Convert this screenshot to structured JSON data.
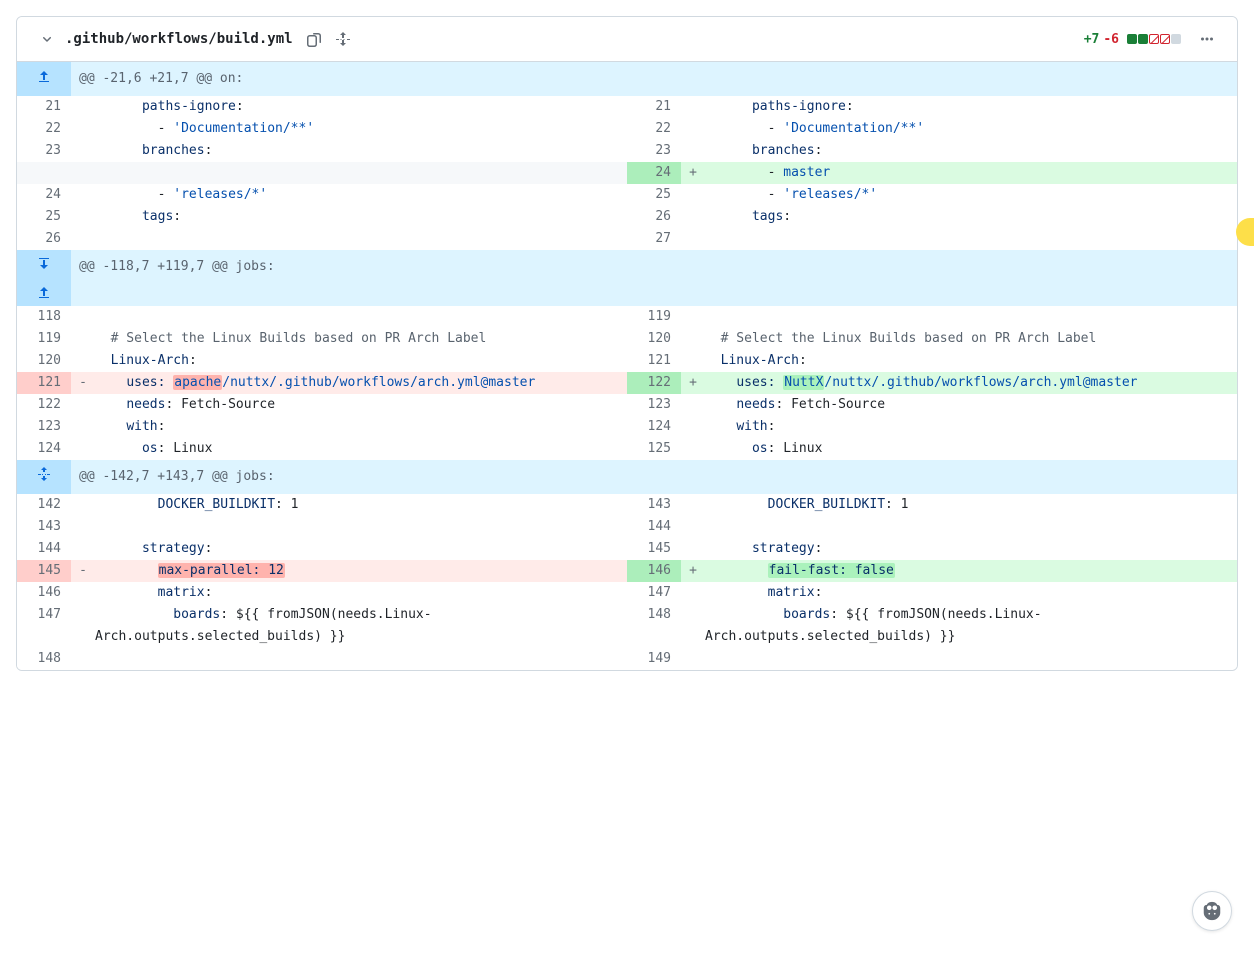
{
  "file": {
    "path": ".github/workflows/build.yml",
    "stats": {
      "additions": "+7",
      "deletions": "-6"
    }
  },
  "hunks": [
    {
      "header": "@@ -21,6 +21,7 @@ on:",
      "expand": "up",
      "rows": [
        {
          "t": "ctx",
          "ll": "21",
          "rl": "21",
          "l": "      paths-ignore:",
          "r": "      paths-ignore:",
          "kind": "key"
        },
        {
          "t": "ctx",
          "ll": "22",
          "rl": "22",
          "l": "        - 'Documentation/**'",
          "r": "        - 'Documentation/**'",
          "kind": "str"
        },
        {
          "t": "ctx",
          "ll": "23",
          "rl": "23",
          "l": "      branches:",
          "r": "      branches:",
          "kind": "key"
        },
        {
          "t": "add",
          "rl": "24",
          "r": "        - master",
          "kind": "str"
        },
        {
          "t": "ctx",
          "ll": "24",
          "rl": "25",
          "l": "        - 'releases/*'",
          "r": "        - 'releases/*'",
          "kind": "str"
        },
        {
          "t": "ctx",
          "ll": "25",
          "rl": "26",
          "l": "      tags:",
          "r": "      tags:",
          "kind": "key"
        },
        {
          "t": "ctx",
          "ll": "26",
          "rl": "27",
          "l": "",
          "r": ""
        }
      ]
    },
    {
      "header": "@@ -118,7 +119,7 @@ jobs:",
      "expand": "both",
      "rows": [
        {
          "t": "ctx",
          "ll": "118",
          "rl": "119",
          "l": "",
          "r": ""
        },
        {
          "t": "ctx",
          "ll": "119",
          "rl": "120",
          "l": "  # Select the Linux Builds based on PR Arch Label",
          "r": "  # Select the Linux Builds based on PR Arch Label",
          "kind": "comment"
        },
        {
          "t": "ctx",
          "ll": "120",
          "rl": "121",
          "l": "  Linux-Arch:",
          "r": "  Linux-Arch:",
          "kind": "key"
        },
        {
          "t": "chg",
          "ll": "121",
          "rl": "122",
          "l_parts": [
            {
              "txt": "    ",
              "cls": ""
            },
            {
              "txt": "uses: ",
              "cls": "tok-key"
            },
            {
              "txt": "apache",
              "cls": "marker-del tok-str"
            },
            {
              "txt": "/nuttx/.github/workflows/arch.yml@master",
              "cls": "tok-str"
            }
          ],
          "r_parts": [
            {
              "txt": "    ",
              "cls": ""
            },
            {
              "txt": "uses: ",
              "cls": "tok-key"
            },
            {
              "txt": "NuttX",
              "cls": "marker-add tok-str"
            },
            {
              "txt": "/nuttx/.github/workflows/arch.yml@master",
              "cls": "tok-str"
            }
          ]
        },
        {
          "t": "ctx",
          "ll": "122",
          "rl": "123",
          "l": "    needs: Fetch-Source",
          "r": "    needs: Fetch-Source",
          "kind": "keyval"
        },
        {
          "t": "ctx",
          "ll": "123",
          "rl": "124",
          "l": "    with:",
          "r": "    with:",
          "kind": "key"
        },
        {
          "t": "ctx",
          "ll": "124",
          "rl": "125",
          "l": "      os: Linux",
          "r": "      os: Linux",
          "kind": "keyval"
        }
      ]
    },
    {
      "header": "@@ -142,7 +143,7 @@ jobs:",
      "expand": "split",
      "rows": [
        {
          "t": "ctx",
          "ll": "142",
          "rl": "143",
          "l": "        DOCKER_BUILDKIT: 1",
          "r": "        DOCKER_BUILDKIT: 1",
          "kind": "keyval"
        },
        {
          "t": "ctx",
          "ll": "143",
          "rl": "144",
          "l": "",
          "r": ""
        },
        {
          "t": "ctx",
          "ll": "144",
          "rl": "145",
          "l": "      strategy:",
          "r": "      strategy:",
          "kind": "key"
        },
        {
          "t": "chg",
          "ll": "145",
          "rl": "146",
          "l_parts": [
            {
              "txt": "        ",
              "cls": ""
            },
            {
              "txt": "max-parallel: 12",
              "cls": "marker-del tok-key"
            }
          ],
          "r_parts": [
            {
              "txt": "        ",
              "cls": ""
            },
            {
              "txt": "fail-fast: false",
              "cls": "marker-add tok-key"
            }
          ]
        },
        {
          "t": "ctx",
          "ll": "146",
          "rl": "147",
          "l": "        matrix:",
          "r": "        matrix:",
          "kind": "key"
        },
        {
          "t": "ctx",
          "ll": "147",
          "rl": "148",
          "l": "          boards: ${{ fromJSON(needs.Linux-Arch.outputs.selected_builds) }}",
          "r": "          boards: ${{ fromJSON(needs.Linux-Arch.outputs.selected_builds) }}",
          "kind": "keyval"
        },
        {
          "t": "ctx",
          "ll": "148",
          "rl": "149",
          "l": "",
          "r": ""
        }
      ]
    }
  ]
}
